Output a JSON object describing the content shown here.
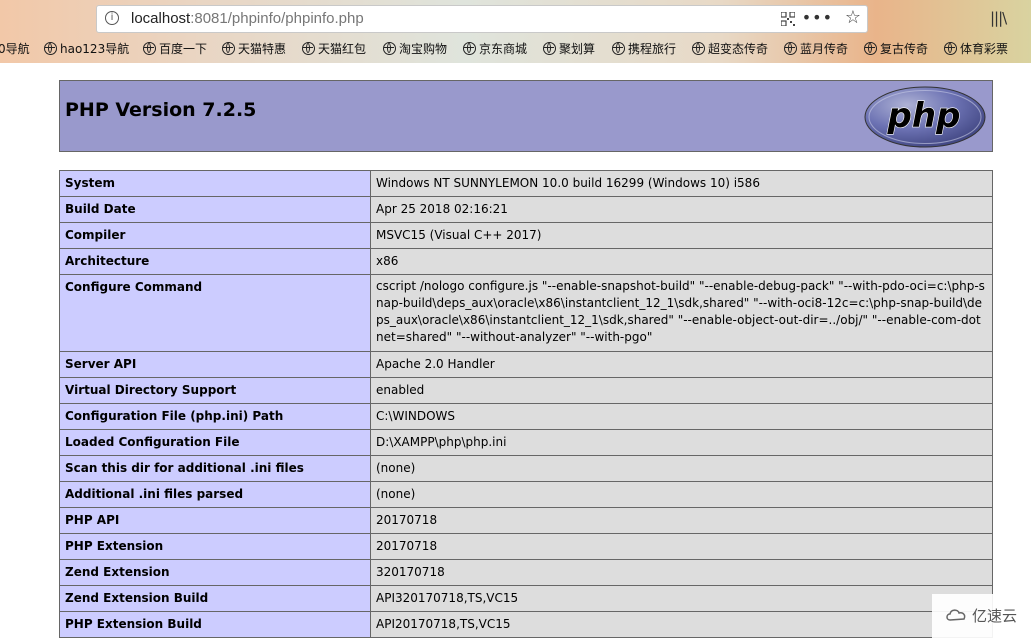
{
  "browser": {
    "url_host": "localhost",
    "url_rest": ":8081/phpinfo/phpinfo.php",
    "more_label": "•••",
    "bookmarks": [
      "0导航",
      "hao123导航",
      "百度一下",
      "天猫特惠",
      "天猫红包",
      "淘宝购物",
      "京东商城",
      "聚划算",
      "携程旅行",
      "超变态传奇",
      "蓝月传奇",
      "复古传奇",
      "体育彩票"
    ]
  },
  "phpinfo": {
    "title": "PHP Version 7.2.5",
    "logo_text": "php",
    "rows": [
      {
        "label": "System",
        "value": "Windows NT SUNNYLEMON 10.0 build 16299 (Windows 10) i586"
      },
      {
        "label": "Build Date",
        "value": "Apr 25 2018 02:16:21"
      },
      {
        "label": "Compiler",
        "value": "MSVC15 (Visual C++ 2017)"
      },
      {
        "label": "Architecture",
        "value": "x86"
      },
      {
        "label": "Configure Command",
        "value": "cscript /nologo configure.js \"--enable-snapshot-build\" \"--enable-debug-pack\" \"--with-pdo-oci=c:\\php-snap-build\\deps_aux\\oracle\\x86\\instantclient_12_1\\sdk,shared\" \"--with-oci8-12c=c:\\php-snap-build\\deps_aux\\oracle\\x86\\instantclient_12_1\\sdk,shared\" \"--enable-object-out-dir=../obj/\" \"--enable-com-dotnet=shared\" \"--without-analyzer\" \"--with-pgo\""
      },
      {
        "label": "Server API",
        "value": "Apache 2.0 Handler"
      },
      {
        "label": "Virtual Directory Support",
        "value": "enabled"
      },
      {
        "label": "Configuration File (php.ini) Path",
        "value": "C:\\WINDOWS"
      },
      {
        "label": "Loaded Configuration File",
        "value": "D:\\XAMPP\\php\\php.ini"
      },
      {
        "label": "Scan this dir for additional .ini files",
        "value": "(none)"
      },
      {
        "label": "Additional .ini files parsed",
        "value": "(none)"
      },
      {
        "label": "PHP API",
        "value": "20170718"
      },
      {
        "label": "PHP Extension",
        "value": "20170718"
      },
      {
        "label": "Zend Extension",
        "value": "320170718"
      },
      {
        "label": "Zend Extension Build",
        "value": "API320170718,TS,VC15"
      },
      {
        "label": "PHP Extension Build",
        "value": "API20170718,TS,VC15"
      }
    ]
  },
  "watermark": {
    "text": "亿速云"
  }
}
